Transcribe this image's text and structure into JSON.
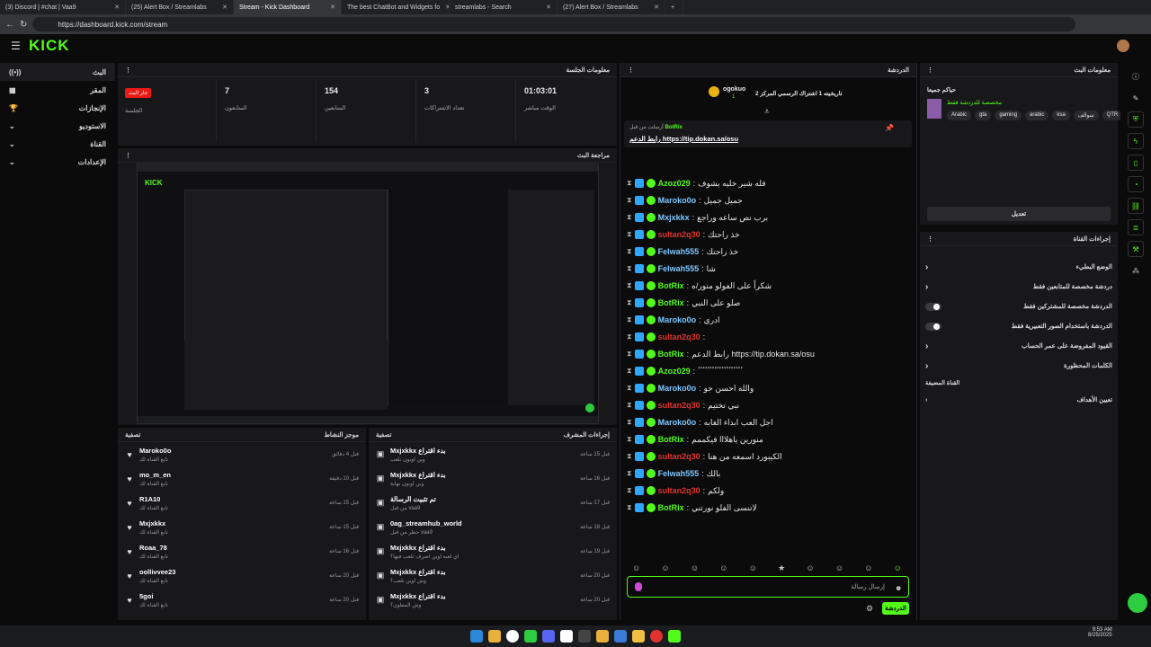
{
  "browser": {
    "tabs": [
      {
        "label": "(3) Discord | #chat | Vaa9"
      },
      {
        "label": "(25) Alert Box / Streamlabs"
      },
      {
        "label": "Stream - Kick Dashboard"
      },
      {
        "label": "The best ChatBot and Widgets fo"
      },
      {
        "label": "streamlabs - Search"
      },
      {
        "label": "(27) Alert Box / Streamlabs"
      }
    ],
    "url": "https://dashboard.kick.com/stream"
  },
  "logo": "KICK",
  "sidebar": {
    "items": [
      {
        "label": "البث"
      },
      {
        "label": "المقر"
      },
      {
        "label": "الإنجازات"
      },
      {
        "label": "الاستوديو"
      },
      {
        "label": "القناة"
      },
      {
        "label": "الإعدادات"
      }
    ]
  },
  "session": {
    "title": "معلومات الجلسة",
    "badge": "جار البث",
    "stats": [
      {
        "value": "",
        "label": "الجلسة"
      },
      {
        "value": "7",
        "label": "المتابعون"
      },
      {
        "value": "154",
        "label": "المتابعين"
      },
      {
        "value": "3",
        "label": "تعداد الاشتراكات"
      },
      {
        "value": "01:03:01",
        "label": "الوقت مباشر"
      }
    ]
  },
  "preview": {
    "title": "مراجعة البث"
  },
  "activity": {
    "title": "موجز النشاط",
    "filter": "تصفية",
    "rows": [
      {
        "name": "Marokо0o",
        "sub": "تابع القناة لك",
        "time": "قبل 4 دقائق"
      },
      {
        "name": "mo_m_en",
        "sub": "تابع القناة لك",
        "time": "قبل 10 دقيقة"
      },
      {
        "name": "R1A10",
        "sub": "تابع القناة لك",
        "time": "قبل 15 ساعة"
      },
      {
        "name": "Mxjxkkx",
        "sub": "تابع القناة لك",
        "time": "قبل 15 ساعة"
      },
      {
        "name": "Roaa_78",
        "sub": "تابع القناة لك",
        "time": "قبل 16 ساعة"
      },
      {
        "name": "oollivvee23",
        "sub": "تابع القناة لك",
        "time": "قبل 20 ساعة"
      },
      {
        "name": "5goi",
        "sub": "تابع القناة لك",
        "time": "قبل 20 ساعة"
      }
    ]
  },
  "modactions": {
    "title": "إجراءات المشرف",
    "filter": "تصفية",
    "rows": [
      {
        "name": "Mxjxkkx بدء اقتراع",
        "sub": "وين اوبون نلعب",
        "time": "قبل 15 ساعة"
      },
      {
        "name": "Mxjxkkx بدء اقتراع",
        "sub": "وين اوبون نهاية",
        "time": "قبل 16 ساعة"
      },
      {
        "name": "تم تثبيت الرسالة",
        "sub": "من قبل vaa9",
        "time": "قبل 17 ساعة"
      },
      {
        "name": "0ag_streamhub_world",
        "sub": "حظر من قبل vaa9",
        "time": "قبل 18 ساعة"
      },
      {
        "name": "Mxjxkkx بدء اقتراع",
        "sub": "اي لعبه اوين اصرف تلعب فيها؟",
        "time": "قبل 19 ساعة"
      },
      {
        "name": "Mxjxkkx بدء اقتراع",
        "sub": "وش اوين نلعب؟",
        "time": "قبل 20 ساعة"
      },
      {
        "name": "Mxjxkkx بدء اقتراع",
        "sub": "وش المطون؟",
        "time": "قبل 20 ساعة"
      }
    ]
  },
  "chat": {
    "title": "الدردشة",
    "top_gifter": "ogokuo",
    "top_gifter_count": "1",
    "gift_text": "تاريخيته 1 اشتراك الرسمي المركز 2",
    "pinned_by": "أرسلت من قبل",
    "pinned_user": "BotRix",
    "pinned_text": "رابط الدعم https://tip.dokan.sa/osu",
    "input_placeholder": "إرسال رسالة",
    "send_label": "الدردشة",
    "lines": [
      {
        "user": "Azoz029",
        "color": "#53fc18",
        "text": "فله شير خليه يشوف"
      },
      {
        "user": "Marokо0o",
        "color": "#7ec8ff",
        "text": "جميل جميل"
      },
      {
        "user": "Mxjxkkx",
        "color": "#7ec8ff",
        "text": "برب نص ساعه وراجع"
      },
      {
        "user": "sultan2q30",
        "color": "#e0332f",
        "text": "خذ راحتك"
      },
      {
        "user": "Felwah555",
        "color": "#7ec8ff",
        "text": "خذ راحتك"
      },
      {
        "user": "Felwah555",
        "color": "#7ec8ff",
        "text": "شا"
      },
      {
        "user": "BotRix",
        "color": "#53fc18",
        "text": "شكراً على الفولو منور/ه"
      },
      {
        "user": "BotRix",
        "color": "#53fc18",
        "text": "صلو على النبي"
      },
      {
        "user": "Marokо0o",
        "color": "#7ec8ff",
        "text": "ادري"
      },
      {
        "user": "sultan2q30",
        "color": "#e0332f",
        "text": ""
      },
      {
        "user": "BotRix",
        "color": "#53fc18",
        "text": "رابط الدعم https://tip.dokan.sa/osu"
      },
      {
        "user": "Azoz029",
        "color": "#53fc18",
        "text": "ٴٴٴٴٴٴٴٴٴٴٴٴٴٴٴٴٴٴٴ"
      },
      {
        "user": "Marokо0o",
        "color": "#7ec8ff",
        "text": "والله احسن جو"
      },
      {
        "user": "sultan2q30",
        "color": "#e0332f",
        "text": "نبي تختيم"
      },
      {
        "user": "Marokо0o",
        "color": "#7ec8ff",
        "text": "اجل العب ابداء الغابه"
      },
      {
        "user": "BotRix",
        "color": "#53fc18",
        "text": "منورين ياهلااا فيكممم"
      },
      {
        "user": "sultan2q30",
        "color": "#e0332f",
        "text": "الكيبورد اسمعه من هنا"
      },
      {
        "user": "Felwah555",
        "color": "#7ec8ff",
        "text": "بالك"
      },
      {
        "user": "sultan2q30",
        "color": "#e0332f",
        "text": "ولكم"
      },
      {
        "user": "BotRix",
        "color": "#53fc18",
        "text": "لاتنسى الفلو نورتني"
      }
    ]
  },
  "streaminfo": {
    "title": "معلومات البث",
    "subtitle": "حياكم جميعا",
    "category": "مخصصة للدردشة فقط",
    "tags": [
      "Arabic",
      "gta",
      "gaming",
      "arabic",
      "ksa",
      "سوالف",
      "QTR"
    ],
    "edit_label": "تعديل"
  },
  "channel_actions": {
    "title": "إجراءات القناة",
    "rows": [
      {
        "label": "الوضع البطيء",
        "type": "chevron"
      },
      {
        "label": "دردشة مخصصة للمتابعين فقط",
        "type": "chevron"
      },
      {
        "label": "الدردشة مخصصة للمشتركين فقط",
        "type": "toggle"
      },
      {
        "label": "الدردشة باستخدام الصور التعبيرية فقط",
        "type": "toggle"
      },
      {
        "label": "القيود المفروضة على عمر الحساب",
        "type": "chevron"
      },
      {
        "label": "الكلمات المحظورة",
        "type": "chevron"
      }
    ],
    "section2": "القناة المضيفة",
    "host_label": "تعيين الأهداف"
  },
  "clock": {
    "time": "9:53 AM",
    "date": "8/25/2025"
  }
}
